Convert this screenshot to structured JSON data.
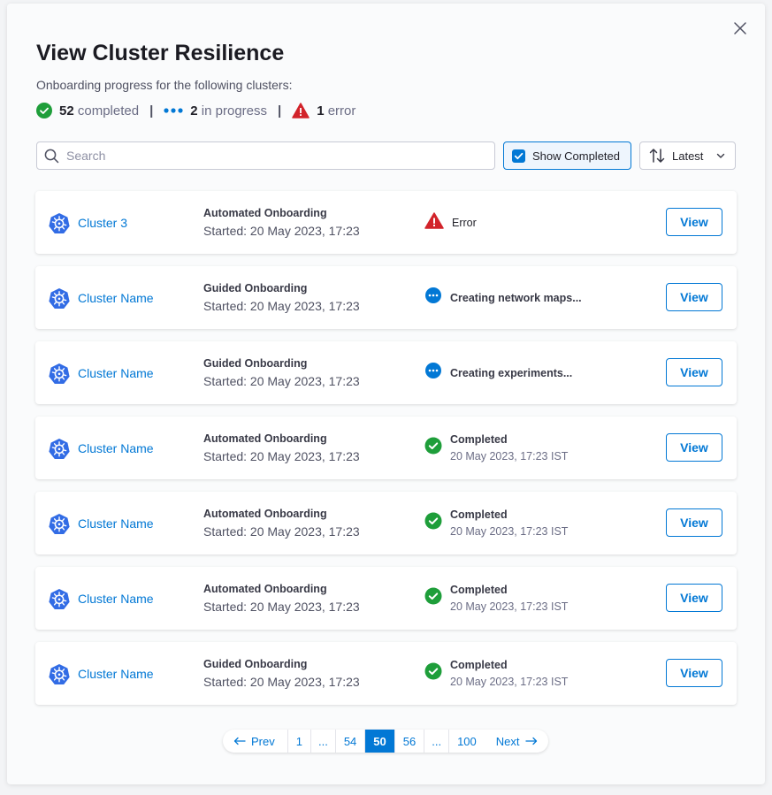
{
  "dialog": {
    "title": "View Cluster Resilience",
    "subtitle": "Onboarding progress for the following clusters:",
    "summary": {
      "completed_count": "52",
      "completed_label": "completed",
      "progress_count": "2",
      "progress_label": "in progress",
      "error_count": "1",
      "error_label": "error"
    }
  },
  "toolbar": {
    "search_placeholder": "Search",
    "show_completed_label": "Show Completed",
    "show_completed_checked": true,
    "sort_label": "Latest"
  },
  "rows": [
    {
      "name": "Cluster 3",
      "type": "Automated Onboarding",
      "started": "Started: 20 May 2023, 17:23",
      "status": "error",
      "status_text": "Error",
      "status_sub": "",
      "action": "View"
    },
    {
      "name": "Cluster Name",
      "type": "Guided Onboarding",
      "started": "Started: 20 May 2023, 17:23",
      "status": "progress",
      "status_text": "Creating network maps...",
      "status_sub": "",
      "action": "View"
    },
    {
      "name": "Cluster Name",
      "type": "Guided Onboarding",
      "started": "Started: 20 May 2023, 17:23",
      "status": "progress",
      "status_text": "Creating experiments...",
      "status_sub": "",
      "action": "View"
    },
    {
      "name": "Cluster Name",
      "type": "Automated Onboarding",
      "started": "Started: 20 May 2023, 17:23",
      "status": "completed",
      "status_text": "Completed",
      "status_sub": "20 May 2023, 17:23 IST",
      "action": "View"
    },
    {
      "name": "Cluster Name",
      "type": "Automated Onboarding",
      "started": "Started: 20 May 2023, 17:23",
      "status": "completed",
      "status_text": "Completed",
      "status_sub": "20 May 2023, 17:23 IST",
      "action": "View"
    },
    {
      "name": "Cluster Name",
      "type": "Automated Onboarding",
      "started": "Started: 20 May 2023, 17:23",
      "status": "completed",
      "status_text": "Completed",
      "status_sub": "20 May 2023, 17:23 IST",
      "action": "View"
    },
    {
      "name": "Cluster Name",
      "type": "Guided Onboarding",
      "started": "Started: 20 May 2023, 17:23",
      "status": "completed",
      "status_text": "Completed",
      "status_sub": "20 May 2023, 17:23 IST",
      "action": "View"
    }
  ],
  "pagination": {
    "prev_label": "Prev",
    "next_label": "Next",
    "pages": [
      "1",
      "...",
      "54",
      "50",
      "56",
      "...",
      "100"
    ],
    "active": "50"
  },
  "icons": {
    "close": "close-icon",
    "search": "search-icon",
    "check": "check-icon",
    "sort": "sort-arrows-icon",
    "chevron": "chevron-down-icon",
    "cluster": "kubernetes-icon",
    "error": "warning-triangle-icon",
    "progress": "in-progress-icon",
    "completed": "check-circle-icon",
    "prev": "arrow-left-icon",
    "next": "arrow-right-icon"
  },
  "colors": {
    "accent": "#0278d5",
    "success": "#1e9e3a",
    "error": "#d2232a",
    "kubernetes": "#326ce5"
  }
}
